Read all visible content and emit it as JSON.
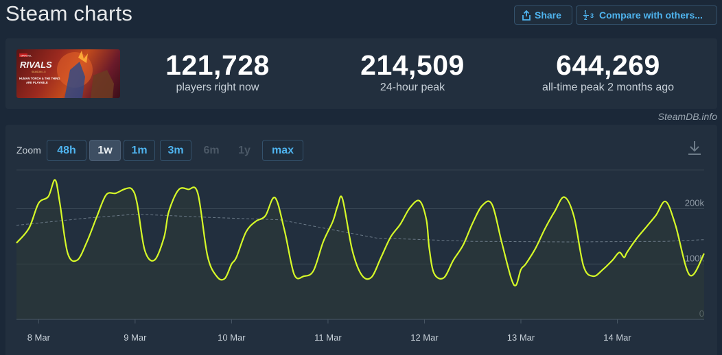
{
  "header": {
    "title": "Steam charts",
    "share_label": "Share",
    "compare_label": "Compare with others..."
  },
  "game_banner": {
    "logo_text": "RIVALS",
    "season_text": "SEASON 1.5",
    "tagline": "HUMAN TORCH & THE THING ARE PLAYABLE"
  },
  "stats": [
    {
      "value": "121,728",
      "label": "players right now"
    },
    {
      "value": "214,509",
      "label": "24-hour peak"
    },
    {
      "value": "644,269",
      "label": "all-time peak 2 months ago"
    }
  ],
  "credit": "SteamDB.info",
  "zoom": {
    "label": "Zoom",
    "options": [
      {
        "label": "48h",
        "state": "normal"
      },
      {
        "label": "1w",
        "state": "active"
      },
      {
        "label": "1m",
        "state": "normal"
      },
      {
        "label": "3m",
        "state": "normal"
      },
      {
        "label": "6m",
        "state": "disabled"
      },
      {
        "label": "1y",
        "state": "disabled"
      },
      {
        "label": "max",
        "state": "normal"
      }
    ]
  },
  "download_icon": "download-icon",
  "colors": {
    "players_line": "#d6f928",
    "average_line": "#6b7a88",
    "accent": "#4fb4ef"
  },
  "chart_data": {
    "type": "line",
    "xlabel": "",
    "ylabel": "",
    "x_ticks": [
      "8 Mar",
      "9 Mar",
      "10 Mar",
      "11 Mar",
      "12 Mar",
      "13 Mar",
      "14 Mar"
    ],
    "y_ticks": [
      "0",
      "100k",
      "200k"
    ],
    "ylim": [
      0,
      270000
    ],
    "xlim": [
      -0.23,
      6.9
    ],
    "grid": true,
    "series": [
      {
        "style": "solid",
        "x": [
          -0.23,
          -0.1,
          0.0,
          0.1,
          0.17,
          0.22,
          0.3,
          0.4,
          0.5,
          0.6,
          0.7,
          0.8,
          0.9,
          0.97,
          1.02,
          1.1,
          1.2,
          1.3,
          1.35,
          1.45,
          1.55,
          1.65,
          1.75,
          1.85,
          1.93,
          2.0,
          2.05,
          2.15,
          2.25,
          2.35,
          2.45,
          2.55,
          2.65,
          2.75,
          2.85,
          2.95,
          3.05,
          3.1,
          3.15,
          3.25,
          3.35,
          3.45,
          3.55,
          3.65,
          3.75,
          3.85,
          3.95,
          4.02,
          4.05,
          4.1,
          4.2,
          4.3,
          4.4,
          4.5,
          4.6,
          4.7,
          4.8,
          4.9,
          4.95,
          5.0,
          5.05,
          5.15,
          5.25,
          5.35,
          5.45,
          5.55,
          5.65,
          5.75,
          5.85,
          5.95,
          6.02,
          6.07,
          6.1,
          6.2,
          6.3,
          6.4,
          6.5,
          6.6,
          6.75,
          6.9
        ],
        "y": [
          138000,
          165000,
          210000,
          222000,
          252000,
          210000,
          120000,
          107000,
          140000,
          184000,
          225000,
          228000,
          236000,
          235000,
          210000,
          125000,
          107000,
          148000,
          195000,
          234000,
          235000,
          228000,
          115000,
          77000,
          74000,
          100000,
          112000,
          158000,
          177000,
          187000,
          220000,
          160000,
          81000,
          78000,
          88000,
          140000,
          177000,
          205000,
          218000,
          126000,
          80000,
          76000,
          112000,
          149000,
          172000,
          202000,
          214000,
          180000,
          128000,
          83000,
          75000,
          107000,
          134000,
          174000,
          206000,
          208000,
          140000,
          74000,
          62000,
          90000,
          100000,
          128000,
          164000,
          195000,
          221000,
          186000,
          96000,
          78000,
          90000,
          107000,
          121000,
          112000,
          121000,
          146000,
          167000,
          188000,
          213000,
          172000,
          80000,
          119000
        ]
      },
      {
        "style": "dashed",
        "x": [
          -0.23,
          0.5,
          1.0,
          1.3,
          1.8,
          2.5,
          3.5,
          4.5,
          5.5,
          6.5,
          6.9
        ],
        "y": [
          170000,
          183000,
          190000,
          188000,
          184000,
          180000,
          147000,
          141000,
          140000,
          141000,
          144000
        ]
      }
    ]
  }
}
